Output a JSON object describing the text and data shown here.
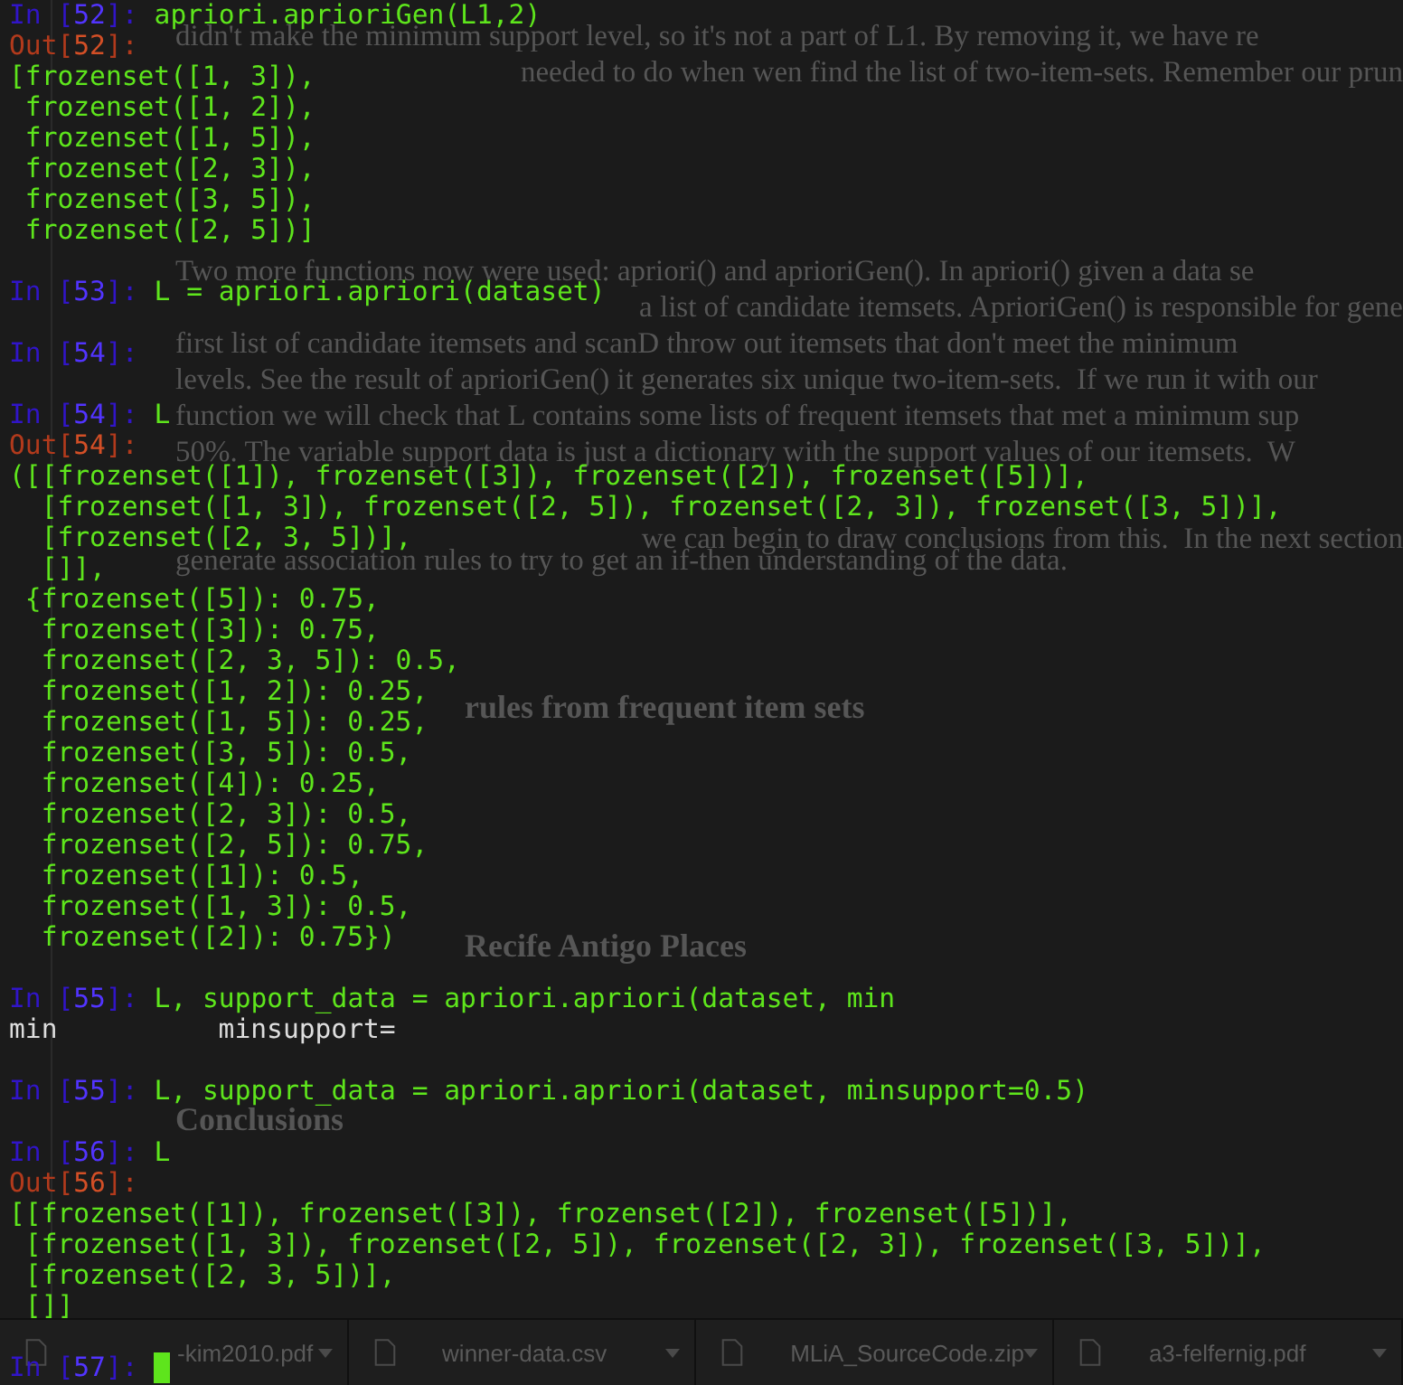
{
  "document": {
    "blocks": [
      {
        "kind": "paragraph",
        "lines": [
          {
            "kind": "line",
            "text": "didn't make the minimum support level, so it's not a part of L1. By removing it, we have re"
          },
          {
            "kind": "tail",
            "text": "needed to do when wen find the list of two-item-sets. Remember our prun"
          }
        ]
      },
      {
        "kind": "paragraph",
        "lines": [
          {
            "kind": "line",
            "text": "Two more functions now were used: apriori() and aprioriGen(). In apriori() given a data se"
          },
          {
            "kind": "tail",
            "text": "a list of candidate itemsets. AprioriGen() is responsible for gene"
          },
          {
            "kind": "line",
            "text": "first list of candidate itemsets and scanD throw out itemsets that don't meet the minimum"
          },
          {
            "kind": "line",
            "text": "levels. See the result of aprioriGen() it generates six unique two-item-sets.  If we run it with our"
          },
          {
            "kind": "line",
            "text": "function we will check that L contains some lists of frequent itemsets that met a minimum sup"
          },
          {
            "kind": "line",
            "text": "50%. The variable support data is just a dictionary with the support values of our itemsets.  W"
          },
          {
            "kind": "tail",
            "text": "we can begin to draw conclusions from this.  In the next section"
          },
          {
            "kind": "line",
            "text": "generate association rules to try to get an if-then understanding of the data."
          }
        ]
      },
      {
        "kind": "heading_tail",
        "text": "rules from frequent item sets"
      },
      {
        "kind": "heading_tail",
        "text": "Recife Antigo Places"
      },
      {
        "kind": "heading",
        "text": "Conclusions"
      }
    ]
  },
  "downloads": [
    {
      "name": "-kim2010.pdf"
    },
    {
      "name": "winner-data.csv"
    },
    {
      "name": "MLiA_SourceCode.zip"
    },
    {
      "name": "a3-felfernig.pdf"
    }
  ],
  "console": {
    "lines": [
      {
        "kind": "input",
        "open": "In [",
        "number": "52",
        "close": "]:",
        "code": "apriori.aprioriGen(L1,2)",
        "cursor": false
      },
      {
        "kind": "output",
        "open": "Out[",
        "number": "52",
        "close": "]:"
      },
      {
        "kind": "text",
        "text": "[frozenset([1, 3]),"
      },
      {
        "kind": "text",
        "text": " frozenset([1, 2]),"
      },
      {
        "kind": "text",
        "text": " frozenset([1, 5]),"
      },
      {
        "kind": "text",
        "text": " frozenset([2, 3]),"
      },
      {
        "kind": "text",
        "text": " frozenset([3, 5]),"
      },
      {
        "kind": "text",
        "text": " frozenset([2, 5])]"
      },
      {
        "kind": "blank"
      },
      {
        "kind": "input",
        "open": "In [",
        "number": "53",
        "close": "]:",
        "code": "L = apriori.apriori(dataset)",
        "cursor": false
      },
      {
        "kind": "blank"
      },
      {
        "kind": "input",
        "open": "In [",
        "number": "54",
        "close": "]:",
        "cursor": false
      },
      {
        "kind": "blank"
      },
      {
        "kind": "input",
        "open": "In [",
        "number": "54",
        "close": "]:",
        "code": "L",
        "cursor": false
      },
      {
        "kind": "output",
        "open": "Out[",
        "number": "54",
        "close": "]:"
      },
      {
        "kind": "text",
        "text": "([[frozenset([1]), frozenset([3]), frozenset([2]), frozenset([5])],"
      },
      {
        "kind": "text",
        "text": "  [frozenset([1, 3]), frozenset([2, 5]), frozenset([2, 3]), frozenset([3, 5])],"
      },
      {
        "kind": "text",
        "text": "  [frozenset([2, 3, 5])],"
      },
      {
        "kind": "text",
        "text": "  []],"
      },
      {
        "kind": "text",
        "text": " {frozenset([5]): 0.75,"
      },
      {
        "kind": "text",
        "text": "  frozenset([3]): 0.75,"
      },
      {
        "kind": "text",
        "text": "  frozenset([2, 3, 5]): 0.5,"
      },
      {
        "kind": "text",
        "text": "  frozenset([1, 2]): 0.25,"
      },
      {
        "kind": "text",
        "text": "  frozenset([1, 5]): 0.25,"
      },
      {
        "kind": "text",
        "text": "  frozenset([3, 5]): 0.5,"
      },
      {
        "kind": "text",
        "text": "  frozenset([4]): 0.25,"
      },
      {
        "kind": "text",
        "text": "  frozenset([2, 3]): 0.5,"
      },
      {
        "kind": "text",
        "text": "  frozenset([2, 5]): 0.75,"
      },
      {
        "kind": "text",
        "text": "  frozenset([1]): 0.5,"
      },
      {
        "kind": "text",
        "text": "  frozenset([1, 3]): 0.5,"
      },
      {
        "kind": "text",
        "text": "  frozenset([2]): 0.75})"
      },
      {
        "kind": "blank"
      },
      {
        "kind": "input",
        "open": "In [",
        "number": "55",
        "close": "]:",
        "code": "L, support_data = apriori.apriori(dataset, min",
        "cursor": false
      },
      {
        "kind": "completion",
        "text": "min          minsupport="
      },
      {
        "kind": "blank"
      },
      {
        "kind": "input",
        "open": "In [",
        "number": "55",
        "close": "]:",
        "code": "L, support_data = apriori.apriori(dataset, minsupport=0.5)",
        "cursor": false
      },
      {
        "kind": "blank"
      },
      {
        "kind": "input",
        "open": "In [",
        "number": "56",
        "close": "]:",
        "code": "L",
        "cursor": false
      },
      {
        "kind": "output",
        "open": "Out[",
        "number": "56",
        "close": "]:"
      },
      {
        "kind": "text",
        "text": "[[frozenset([1]), frozenset([3]), frozenset([2]), frozenset([5])],"
      },
      {
        "kind": "text",
        "text": " [frozenset([1, 3]), frozenset([2, 5]), frozenset([2, 3]), frozenset([3, 5])],"
      },
      {
        "kind": "text",
        "text": " [frozenset([2, 3, 5])],"
      },
      {
        "kind": "text",
        "text": " []]"
      },
      {
        "kind": "blank"
      },
      {
        "kind": "input",
        "open": "In [",
        "number": "57",
        "close": "]:",
        "cursor": true
      }
    ]
  }
}
